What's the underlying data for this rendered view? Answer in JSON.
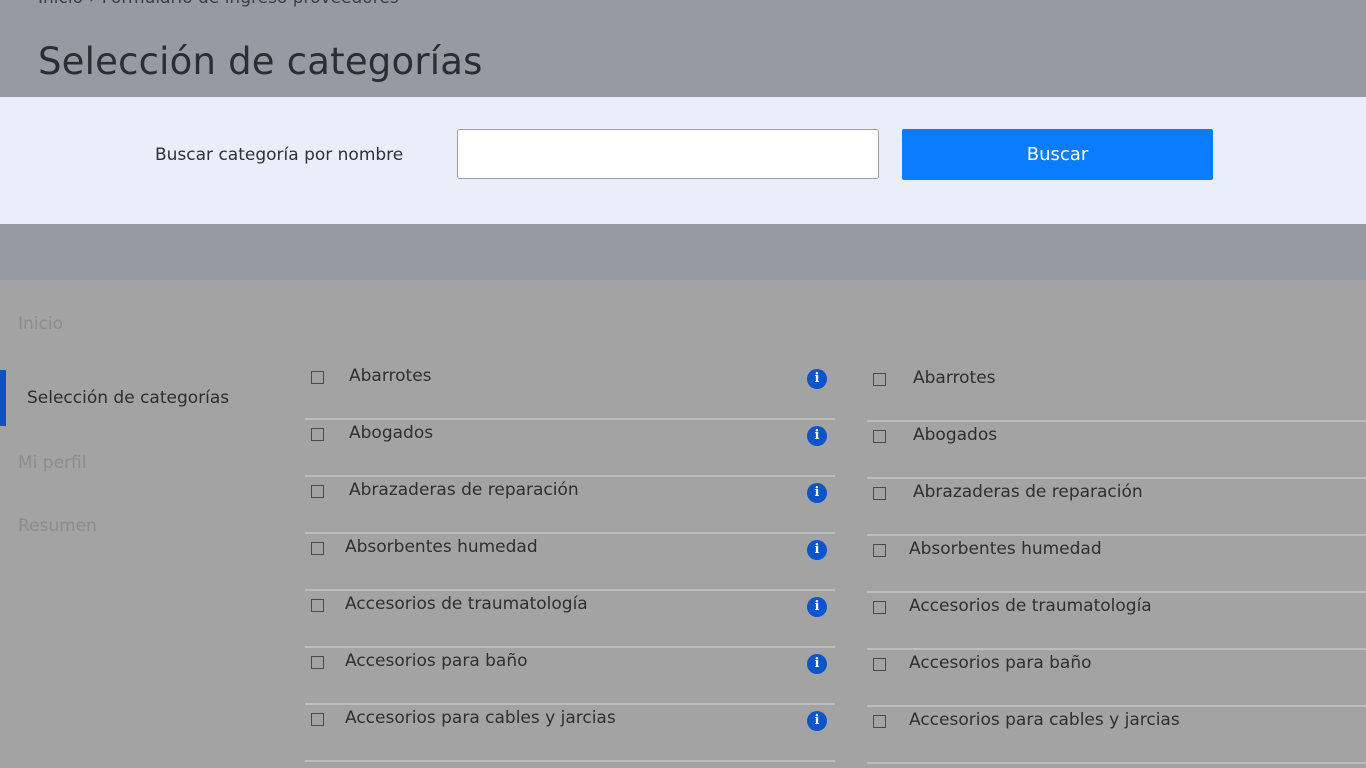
{
  "header": {
    "breadcrumb": [
      "Inicio",
      "Formulario de ingreso proveedores"
    ],
    "breadcrumb_separator": "›",
    "title": "Selección de categorías"
  },
  "search": {
    "label": "Buscar categoría por nombre",
    "value": "",
    "placeholder": "",
    "button_label": "Buscar"
  },
  "sidebar": {
    "items": [
      {
        "label": "Inicio",
        "active": false
      },
      {
        "label": "Selección de categorías",
        "active": true
      },
      {
        "label": "Mi perfil",
        "active": false
      },
      {
        "label": "Resumen",
        "active": false
      }
    ]
  },
  "categories_left": [
    "Abarrotes",
    "Abogados",
    "Abrazaderas de reparación",
    "Absorbentes humedad",
    "Accesorios de traumatología",
    "Accesorios para baño",
    "Accesorios para cables y jarcias"
  ],
  "categories_right": [
    "Abarrotes",
    "Abogados",
    "Abrazaderas de reparación",
    "Absorbentes humedad",
    "Accesorios de traumatología",
    "Accesorios para baño",
    "Accesorios para cables y jarcias"
  ],
  "icons": {
    "info": "info-icon",
    "checkbox": "checkbox-icon"
  },
  "colors": {
    "accent": "#0a7cff",
    "info": "#0a55c8",
    "active_indicator": "#0a53c2"
  }
}
